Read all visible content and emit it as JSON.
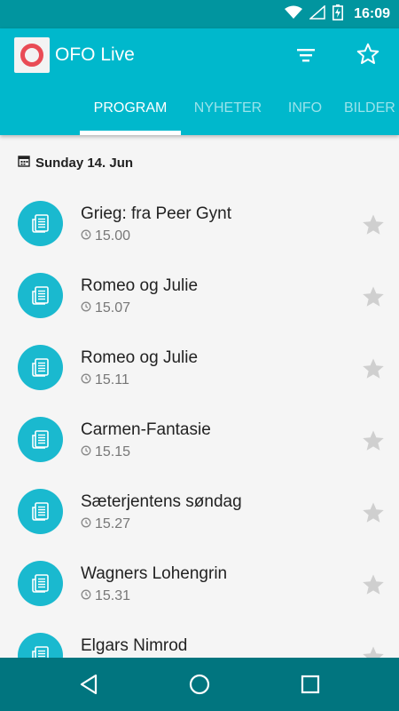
{
  "status_bar": {
    "time": "16:09"
  },
  "app_bar": {
    "title": "OFO Live",
    "accent": "#00b8cc",
    "logo_colors": {
      "ring": "#e94b55",
      "bg": "#f3f3f3"
    }
  },
  "tabs": [
    {
      "label": "PROGRAM",
      "active": true
    },
    {
      "label": "NYHETER",
      "active": false
    },
    {
      "label": "INFO",
      "active": false
    },
    {
      "label": "BILDER",
      "active": false
    }
  ],
  "date_header": {
    "label": "Sunday 14. Jun",
    "icon": "calendar-icon"
  },
  "program": [
    {
      "title": "Grieg: fra Peer Gynt",
      "time": "15.00"
    },
    {
      "title": "Romeo og Julie",
      "time": "15.07"
    },
    {
      "title": "Romeo og Julie",
      "time": "15.11"
    },
    {
      "title": "Carmen-Fantasie",
      "time": "15.15"
    },
    {
      "title": "Sæterjentens søndag",
      "time": "15.27"
    },
    {
      "title": "Wagners Lohengrin",
      "time": "15.31"
    },
    {
      "title": "Elgars Nimrod",
      "time": ""
    }
  ],
  "nav_bar": {
    "icons": [
      "back-icon",
      "home-icon",
      "recents-icon"
    ]
  }
}
